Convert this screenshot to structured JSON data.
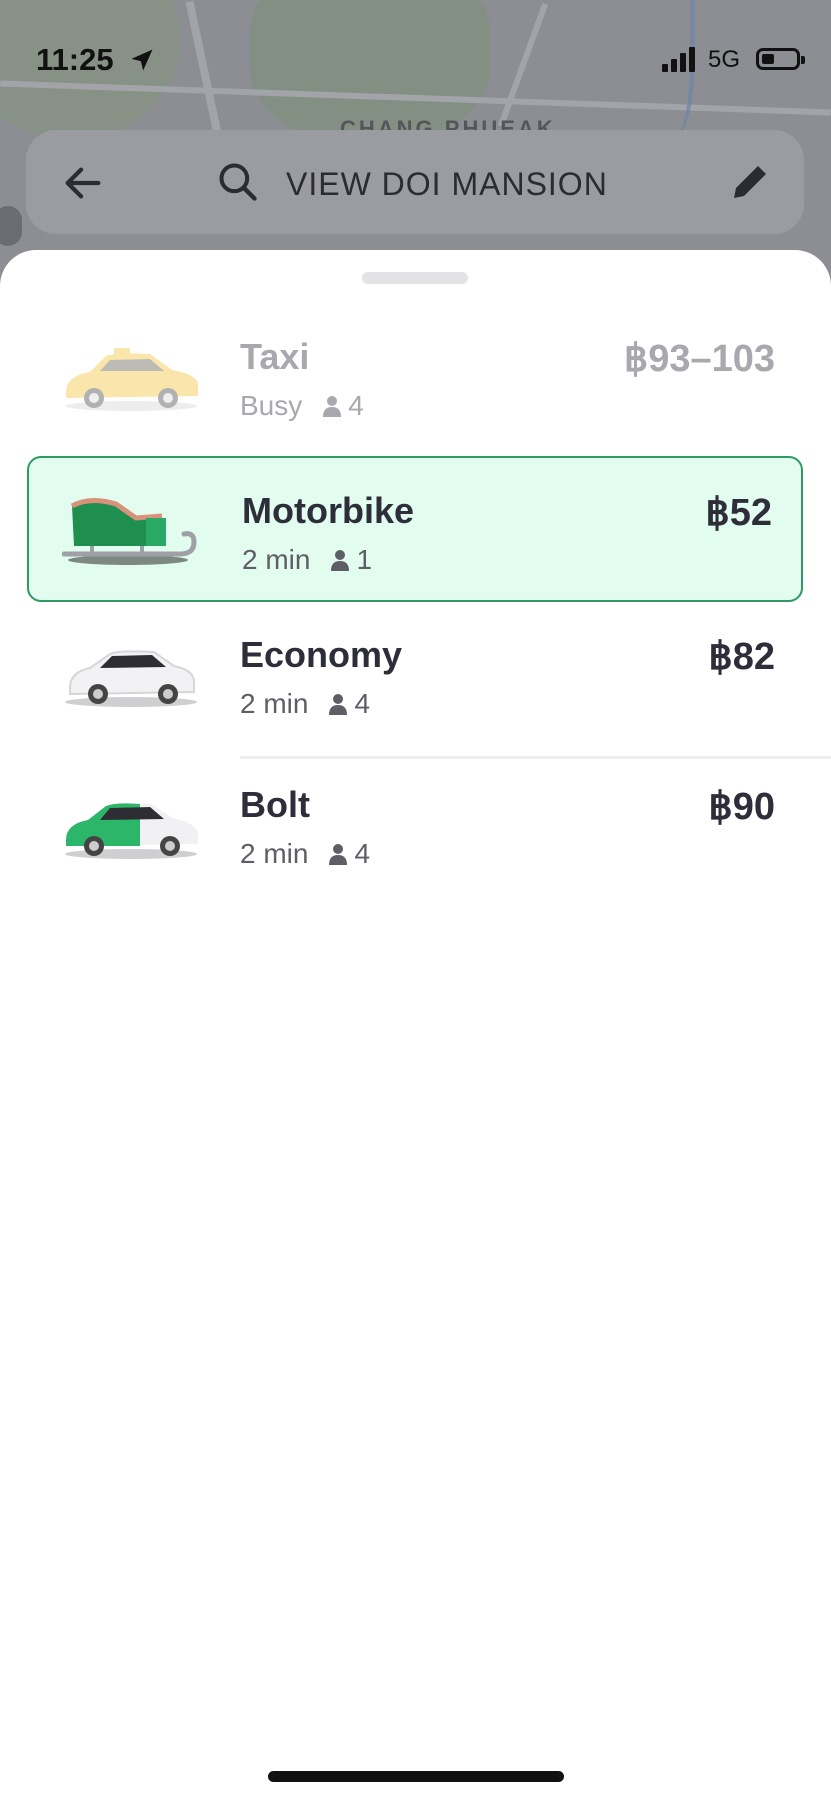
{
  "status_bar": {
    "time": "11:25",
    "network": "5G"
  },
  "map": {
    "label": "CHANG PHUEAK"
  },
  "search": {
    "query": "VIEW DOI MANSION"
  },
  "ride_options": [
    {
      "name": "Taxi",
      "eta": "Busy",
      "seats": "4",
      "price": "฿93–103",
      "state": "busy",
      "icon": "taxi-car-icon"
    },
    {
      "name": "Motorbike",
      "eta": "2 min",
      "seats": "1",
      "price": "฿52",
      "state": "selected",
      "icon": "sleigh-icon"
    },
    {
      "name": "Economy",
      "eta": "2 min",
      "seats": "4",
      "price": "฿82",
      "state": "normal",
      "icon": "white-car-icon"
    },
    {
      "name": "Bolt",
      "eta": "2 min",
      "seats": "4",
      "price": "฿90",
      "state": "normal",
      "icon": "green-car-icon"
    }
  ],
  "colors": {
    "accent": "#2f9a63",
    "selected_bg": "#e2fcef",
    "text": "#2e2e3a"
  }
}
